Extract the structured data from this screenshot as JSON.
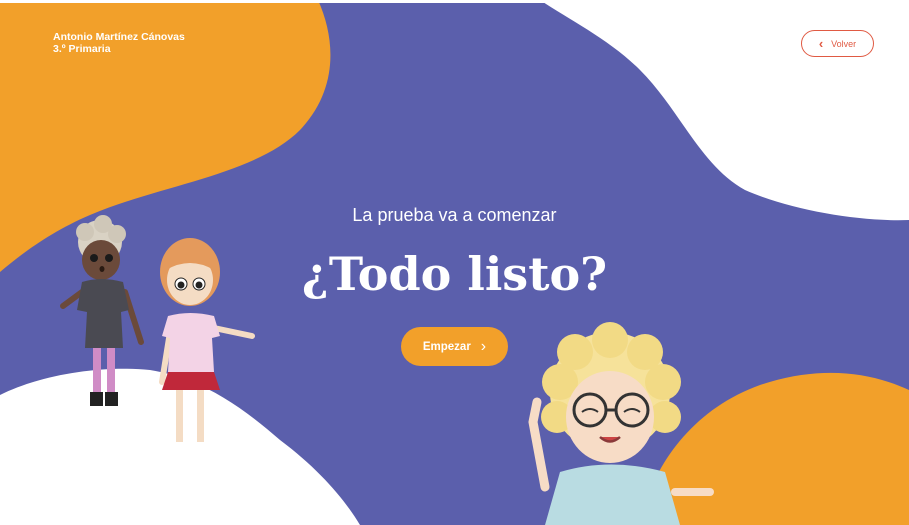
{
  "user": {
    "name": "Antonio Martínez Cánovas",
    "grade": "3.º Primaria"
  },
  "nav": {
    "back_label": "Volver",
    "back_icon": "chevron-left-icon"
  },
  "main": {
    "subtitle": "La prueba va a comenzar",
    "title": "¿Todo listo?",
    "start_label": "Empezar",
    "start_icon": "chevron-right-icon"
  },
  "colors": {
    "background": "#5b5fac",
    "accent_orange": "#f2a02a",
    "back_button_red": "#e05a43",
    "white": "#ffffff"
  }
}
